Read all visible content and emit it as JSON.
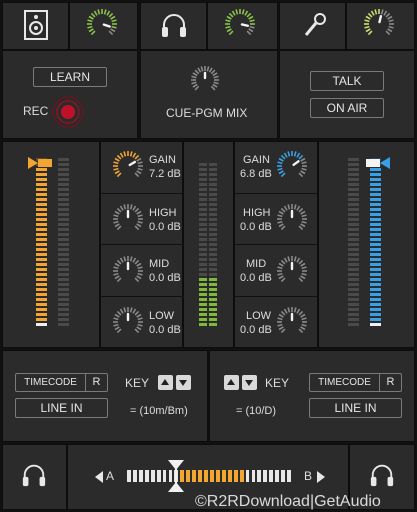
{
  "top": {
    "learn_label": "LEARN",
    "rec_label": "REC",
    "cue_pgm_label": "CUE-PGM MIX",
    "talk_label": "TALK",
    "on_air_label": "ON AIR"
  },
  "eq_left": {
    "gain_label": "GAIN",
    "gain_value": "7.2 dB",
    "high_label": "HIGH",
    "high_value": "0.0 dB",
    "mid_label": "MID",
    "mid_value": "0.0 dB",
    "low_label": "LOW",
    "low_value": "0.0 dB"
  },
  "eq_right": {
    "gain_label": "GAIN",
    "gain_value": "6.8 dB",
    "high_label": "HIGH",
    "high_value": "0.0 dB",
    "mid_label": "MID",
    "mid_value": "0.0 dB",
    "low_label": "LOW",
    "low_value": "0.0 dB"
  },
  "deck_left": {
    "timecode_label": "TIMECODE",
    "r_label": "R",
    "line_in_label": "LINE IN",
    "key_label": "KEY",
    "key_value": "= (10m/Bm)"
  },
  "deck_right": {
    "timecode_label": "TIMECODE",
    "r_label": "R",
    "line_in_label": "LINE IN",
    "key_label": "KEY",
    "key_value": "= (10/D)"
  },
  "crossfader": {
    "a_label": "A",
    "b_label": "B",
    "position": 0.32
  },
  "watermark": "©R2RDownload|GetAudio",
  "colors": {
    "left_accent": "#f2a531",
    "right_accent": "#3aa0e6",
    "master_green": "#7fb83a",
    "rec_red": "#c0102a"
  },
  "levels": {
    "left_fader": 0.95,
    "right_fader": 0.95,
    "left_meter_lit": 0.0,
    "right_meter_lit": 0.0,
    "master_meter_green": 0.32
  }
}
